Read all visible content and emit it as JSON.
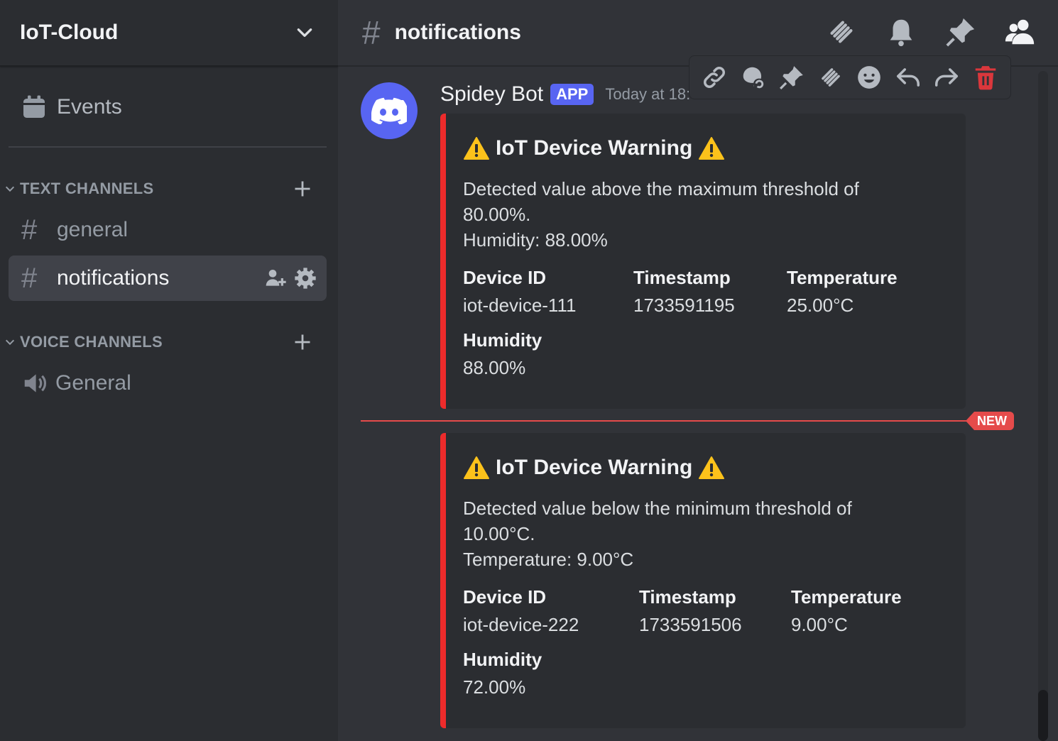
{
  "server": {
    "name": "IoT-Cloud"
  },
  "sidebar": {
    "events_label": "Events",
    "text_category": "TEXT CHANNELS",
    "voice_category": "VOICE CHANNELS",
    "channels": [
      {
        "label": "general",
        "hash": "#"
      },
      {
        "label": "notifications",
        "hash": "#"
      }
    ],
    "voice": [
      {
        "label": "General"
      }
    ]
  },
  "topbar": {
    "hash": "#",
    "title": "notifications"
  },
  "message": {
    "author": "Spidey Bot",
    "badge": "APP",
    "timestamp": "Today at 18:"
  },
  "embeds": [
    {
      "title": "IoT Device Warning",
      "description_line1": "Detected value above the maximum threshold of 80.00%.",
      "description_line2": "Humidity: 88.00%",
      "fields": [
        {
          "name": "Device ID",
          "value": "iot-device-111"
        },
        {
          "name": "Timestamp",
          "value": "1733591195"
        },
        {
          "name": "Temperature",
          "value": "25.00°C"
        },
        {
          "name": "Humidity",
          "value": "88.00%"
        }
      ]
    },
    {
      "title": "IoT Device Warning",
      "description_line1": "Detected value below the minimum threshold of 10.00°C.",
      "description_line2": "Temperature: 9.00°C",
      "fields": [
        {
          "name": "Device ID",
          "value": "iot-device-222"
        },
        {
          "name": "Timestamp",
          "value": "1733591506"
        },
        {
          "name": "Temperature",
          "value": "9.00°C"
        },
        {
          "name": "Humidity",
          "value": "72.00%"
        }
      ]
    }
  ],
  "new_divider": {
    "label": "NEW"
  },
  "colors": {
    "accent": "#5865f2",
    "warning_border": "#ed2b2b",
    "new_red": "#e54b4b",
    "delete_red": "#da373c"
  }
}
